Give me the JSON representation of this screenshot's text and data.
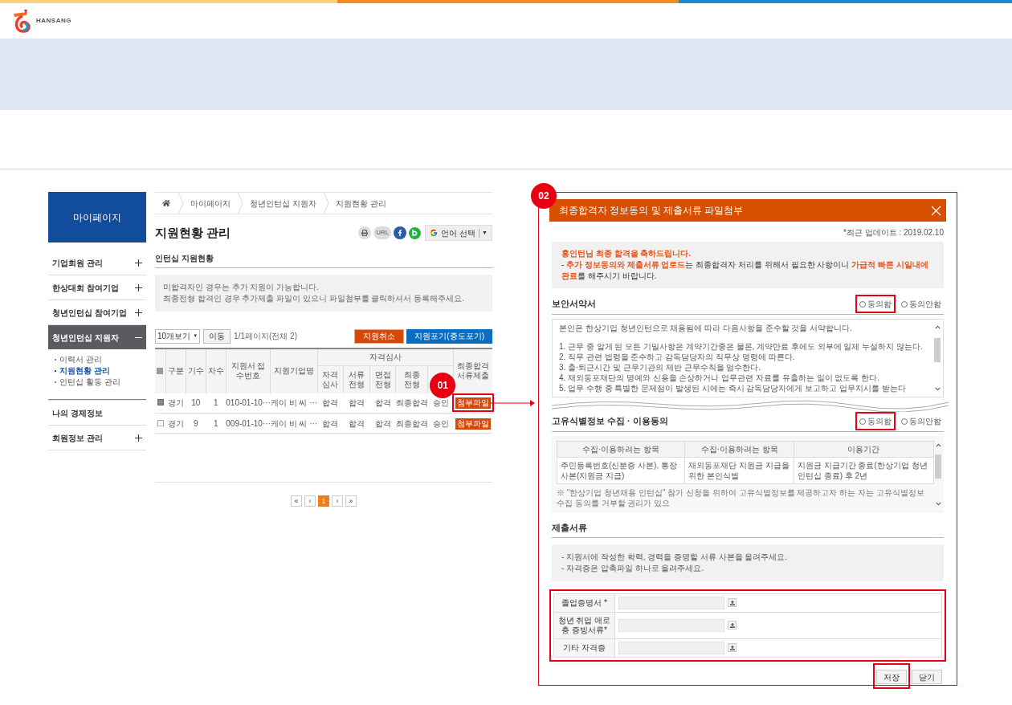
{
  "header": {
    "logo_text": "HANSANG"
  },
  "sidebar": {
    "title": "마이페이지",
    "items": [
      {
        "label": "기업회원 관리",
        "kind": "toggle",
        "expanded": false
      },
      {
        "label": "한상대회 참여기업",
        "kind": "toggle",
        "expanded": false
      },
      {
        "label": "청년인턴십 참여기업",
        "kind": "toggle",
        "expanded": false
      },
      {
        "label": "청년인턴십 지원자",
        "kind": "toggle",
        "expanded": true,
        "children": [
          {
            "label": "이력서 관리",
            "selected": false
          },
          {
            "label": "지원현황 관리",
            "selected": true
          },
          {
            "label": "인턴십 활동 관리",
            "selected": false
          }
        ]
      },
      {
        "label": "나의 경제정보",
        "kind": "link"
      },
      {
        "label": "회원정보 관리",
        "kind": "toggle",
        "expanded": false
      }
    ]
  },
  "breadcrumb": [
    "마이페이지",
    "청년인턴십 지원자",
    "지원현황 관리"
  ],
  "page_title": "지원현황 관리",
  "share": {
    "url_label": "URL",
    "language": "언어 선택",
    "language_caret": "▼"
  },
  "section_title": "인턴십 지원현황",
  "notice": [
    "미합격자인 경우는 추가 지원이 가능합니다.",
    "최종전형 합격인 경우 추가제출 파일이 있으니 파일첨부를 클릭하셔서 등록해주세요."
  ],
  "controls": {
    "page_size": "10개보기",
    "page_size_caret": "▼",
    "go_button": "이동",
    "page_info": "1/1페이지(전체 2)",
    "cancel_button": "지원취소",
    "quit_button": "지원포기(중도포기)"
  },
  "table": {
    "select_all": {
      "indeterminate": true
    },
    "columns": [
      "구분",
      "기수",
      "차수",
      "지원서 접수번호",
      "지원기업명"
    ],
    "group_header": "자격심사",
    "sub_columns": [
      "자격 심사",
      "서류 전형",
      "면접 전형",
      "최종 전형",
      ""
    ],
    "last_column": "최종합격 서류제출",
    "rows": [
      {
        "checked": true,
        "cells": [
          "경기",
          "10",
          "1",
          "010-01-10···",
          "케이 비 씨 ···",
          "합격",
          "합격",
          "합격",
          "최종합격",
          "승인"
        ],
        "file_button": "첨부파일",
        "highlighted": true
      },
      {
        "checked": false,
        "cells": [
          "경기",
          "9",
          "1",
          "009-01-10···",
          "케이 비 씨 ···",
          "합격",
          "합격",
          "합격",
          "최종합격",
          "승인"
        ],
        "file_button": "첨부파일",
        "highlighted": false
      }
    ]
  },
  "pagination": [
    {
      "label": "«",
      "selected": false
    },
    {
      "label": "‹",
      "selected": false
    },
    {
      "label": "1",
      "selected": true
    },
    {
      "label": "›",
      "selected": false
    },
    {
      "label": "»",
      "selected": false
    }
  ],
  "badges": [
    "01",
    "02"
  ],
  "modal": {
    "title": "최종합격자 정보동의 및 제출서류 파일첨부",
    "updated": "*최근 업데이트 : 2019.02.10",
    "greeting": "홍인턴님 최종 합격을 축하드립니다.",
    "greeting_note": "- **추가 정보동의와 제출서류 업로드**는 최종합격자 처리를 위해서 필요한 사항이니 **가급적 빠른 시일내에 완료**를 해주시기 바랍니다.",
    "security": {
      "title": "보안서약서",
      "options": [
        {
          "label": "동의함",
          "selected": false,
          "highlighted": true
        },
        {
          "label": "동의안함",
          "selected": false,
          "highlighted": false
        }
      ],
      "intro": "본인은 한상기업 청년인턴으로 채용됨에 따라 다음사항을 준수할 것을 서약합니다.",
      "items": [
        "1. 근무 중 알게 된 모든 기밀사항은 계약기간중은 물론, 계약만료 후에도 외부에 일체 누설하지 않는다.",
        "2. 직무 관련 법령을 준수하고 감독담당자의 직무상 명령에 따른다.",
        "3. 출·퇴근시간 및 근무기관의 제반 근무수칙을 엄수한다.",
        "4. 재외동포재단의 명예와 신용을 손상하거나 업무관련 자료를 유출하는 일이 없도록 한다.",
        "5. 업무 수행 중 특별한 문제점이 발생된 시에는 즉시 감독담당자에게 보고하고 업무지시를 받는다"
      ]
    },
    "privacy": {
      "title": "고유식별정보 수집 · 이용동의",
      "options": [
        {
          "label": "동의함",
          "selected": false,
          "highlighted": true
        },
        {
          "label": "동의안함",
          "selected": false,
          "highlighted": false
        }
      ],
      "columns": [
        "수집·이용하려는 항목",
        "수집·이용하려는 항목",
        "이용기간"
      ],
      "row": [
        "주민등록번호(신분증 사본), 통장사본(지원금 지급)",
        "재외동포재단 지원금 지급을 위한 본인식별",
        "지원금 지급기간 종료(한상기업 청년인턴십 종료) 후 2년"
      ],
      "note": "※ \"한상기업 청년채용 인턴십\" 참가 신청을 위하여 고유식별정보를 제공하고자 하는 자는 고유식별정보 수집 동의를 거부할 권리가 있으"
    },
    "documents": {
      "title": "제출서류",
      "notice": [
        "- 지원서에 작성한 학력, 경력을 증명할 서류 사본을 올려주세요.",
        "- 자격증은 압축파일 하나로 올려주세요."
      ],
      "files": [
        {
          "label": "졸업증명서 *"
        },
        {
          "label": "청년 취업 애로층 증빙서류*"
        },
        {
          "label": "기타 자격증"
        }
      ]
    },
    "buttons": [
      {
        "label": "저장",
        "highlighted": true
      },
      {
        "label": "닫기",
        "highlighted": false
      }
    ]
  }
}
